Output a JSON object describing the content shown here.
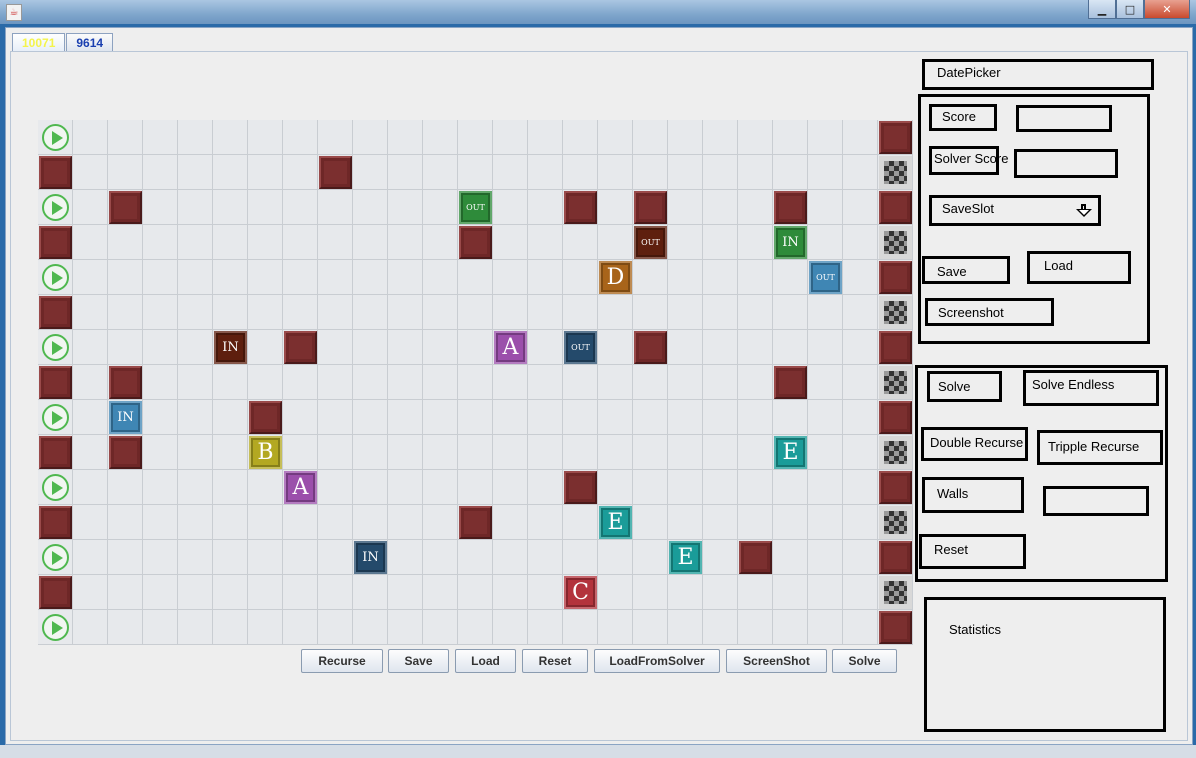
{
  "window": {
    "title": "",
    "minimize": "▁",
    "maximize": "□",
    "close": "✕"
  },
  "tabs": [
    {
      "label": "10071",
      "active": true
    },
    {
      "label": "9614",
      "active": false
    }
  ],
  "board": {
    "cols": 25,
    "rows": 15,
    "pieces": [
      {
        "r": 0,
        "c": 0,
        "t": "play"
      },
      {
        "r": 0,
        "c": 24,
        "t": "wall"
      },
      {
        "r": 1,
        "c": 0,
        "t": "wall"
      },
      {
        "r": 1,
        "c": 8,
        "t": "wall"
      },
      {
        "r": 1,
        "c": 24,
        "t": "checker"
      },
      {
        "r": 2,
        "c": 0,
        "t": "play"
      },
      {
        "r": 2,
        "c": 2,
        "t": "wall"
      },
      {
        "r": 2,
        "c": 12,
        "t": "tile",
        "label": "OUT",
        "color": "#2e8b3a",
        "cls": "out"
      },
      {
        "r": 2,
        "c": 15,
        "t": "wall"
      },
      {
        "r": 2,
        "c": 17,
        "t": "wall"
      },
      {
        "r": 2,
        "c": 21,
        "t": "wall"
      },
      {
        "r": 2,
        "c": 24,
        "t": "wall"
      },
      {
        "r": 3,
        "c": 0,
        "t": "wall"
      },
      {
        "r": 3,
        "c": 12,
        "t": "wall"
      },
      {
        "r": 3,
        "c": 17,
        "t": "tile",
        "label": "OUT",
        "color": "#5e1f0e",
        "cls": "out"
      },
      {
        "r": 3,
        "c": 21,
        "t": "tile",
        "label": "IN",
        "color": "#2e8b3a",
        "cls": "in"
      },
      {
        "r": 3,
        "c": 24,
        "t": "checker"
      },
      {
        "r": 4,
        "c": 0,
        "t": "play"
      },
      {
        "r": 4,
        "c": 16,
        "t": "tile",
        "label": "D",
        "color": "#a8641a",
        "cls": "big"
      },
      {
        "r": 4,
        "c": 22,
        "t": "tile",
        "label": "OUT",
        "color": "#3f86b4",
        "cls": "out"
      },
      {
        "r": 4,
        "c": 24,
        "t": "wall"
      },
      {
        "r": 5,
        "c": 0,
        "t": "wall"
      },
      {
        "r": 5,
        "c": 24,
        "t": "checker"
      },
      {
        "r": 6,
        "c": 0,
        "t": "play"
      },
      {
        "r": 6,
        "c": 5,
        "t": "tile",
        "label": "IN",
        "color": "#5e1f0e",
        "cls": "in"
      },
      {
        "r": 6,
        "c": 7,
        "t": "wall"
      },
      {
        "r": 6,
        "c": 13,
        "t": "tile",
        "label": "A",
        "color": "#9b4fab",
        "cls": "big"
      },
      {
        "r": 6,
        "c": 15,
        "t": "tile",
        "label": "OUT",
        "color": "#244a6b",
        "cls": "out"
      },
      {
        "r": 6,
        "c": 17,
        "t": "wall"
      },
      {
        "r": 6,
        "c": 24,
        "t": "wall"
      },
      {
        "r": 7,
        "c": 0,
        "t": "wall"
      },
      {
        "r": 7,
        "c": 2,
        "t": "wall"
      },
      {
        "r": 7,
        "c": 21,
        "t": "wall"
      },
      {
        "r": 7,
        "c": 24,
        "t": "checker"
      },
      {
        "r": 8,
        "c": 0,
        "t": "play"
      },
      {
        "r": 8,
        "c": 2,
        "t": "tile",
        "label": "IN",
        "color": "#3f86b4",
        "cls": "in"
      },
      {
        "r": 8,
        "c": 6,
        "t": "wall"
      },
      {
        "r": 8,
        "c": 24,
        "t": "wall"
      },
      {
        "r": 9,
        "c": 0,
        "t": "wall"
      },
      {
        "r": 9,
        "c": 2,
        "t": "wall"
      },
      {
        "r": 9,
        "c": 6,
        "t": "tile",
        "label": "B",
        "color": "#b3a822",
        "cls": "big"
      },
      {
        "r": 9,
        "c": 21,
        "t": "tile",
        "label": "E",
        "color": "#1a9c99",
        "cls": "big"
      },
      {
        "r": 9,
        "c": 24,
        "t": "checker"
      },
      {
        "r": 10,
        "c": 0,
        "t": "play"
      },
      {
        "r": 10,
        "c": 7,
        "t": "tile",
        "label": "A",
        "color": "#9b4fab",
        "cls": "big"
      },
      {
        "r": 10,
        "c": 15,
        "t": "wall"
      },
      {
        "r": 10,
        "c": 24,
        "t": "wall"
      },
      {
        "r": 11,
        "c": 0,
        "t": "wall"
      },
      {
        "r": 11,
        "c": 12,
        "t": "wall"
      },
      {
        "r": 11,
        "c": 16,
        "t": "tile",
        "label": "E",
        "color": "#1a9c99",
        "cls": "big"
      },
      {
        "r": 11,
        "c": 24,
        "t": "checker"
      },
      {
        "r": 12,
        "c": 0,
        "t": "play"
      },
      {
        "r": 12,
        "c": 9,
        "t": "tile",
        "label": "IN",
        "color": "#244a6b",
        "cls": "in"
      },
      {
        "r": 12,
        "c": 18,
        "t": "tile",
        "label": "E",
        "color": "#1a9c99",
        "cls": "big"
      },
      {
        "r": 12,
        "c": 20,
        "t": "wall"
      },
      {
        "r": 12,
        "c": 24,
        "t": "wall"
      },
      {
        "r": 13,
        "c": 0,
        "t": "wall"
      },
      {
        "r": 13,
        "c": 15,
        "t": "tile",
        "label": "C",
        "color": "#b3333c",
        "cls": "big"
      },
      {
        "r": 13,
        "c": 24,
        "t": "checker"
      },
      {
        "r": 14,
        "c": 0,
        "t": "play"
      },
      {
        "r": 14,
        "c": 24,
        "t": "wall"
      }
    ]
  },
  "bottom_buttons": {
    "recurse": "Recurse",
    "save": "Save",
    "load": "Load",
    "reset": "Reset",
    "load_from_solver": "LoadFromSolver",
    "screenshot": "ScreenShot",
    "solve": "Solve"
  },
  "side": {
    "datepicker": "DatePicker",
    "score_label": "Score",
    "score_value": "",
    "solver_score_label": "Solver Score",
    "solver_score_value": "",
    "saveslot_label": "SaveSlot",
    "save": "Save",
    "load": "Load",
    "screenshot": "Screenshot",
    "solve": "Solve",
    "solve_endless": "Solve Endless",
    "double_recurse": "Double Recurse",
    "tripple_recurse": "Tripple Recurse",
    "walls": "Walls",
    "walls_value": "",
    "reset": "Reset",
    "statistics": "Statistics"
  }
}
